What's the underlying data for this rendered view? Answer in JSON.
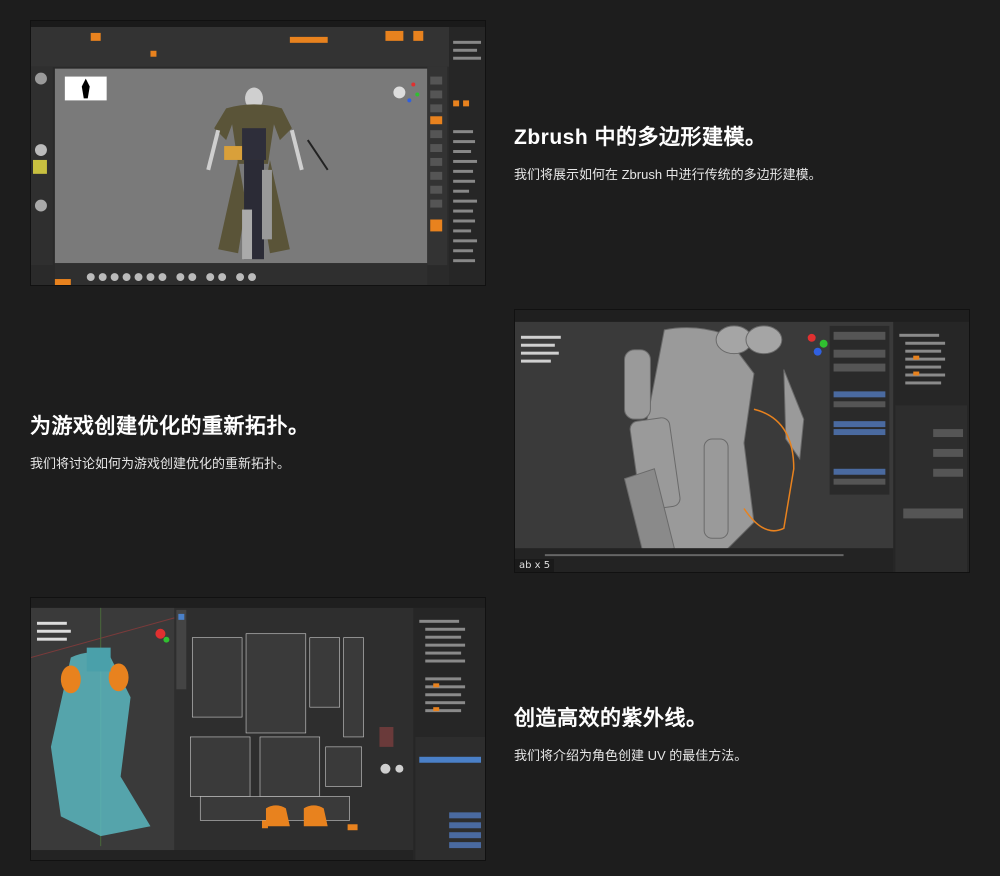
{
  "sections": [
    {
      "heading": "Zbrush 中的多边形建模。",
      "description": "我们将展示如何在 Zbrush 中进行传统的多边形建模。",
      "screenshot": "zbrush-viewport"
    },
    {
      "heading": "为游戏创建优化的重新拓扑。",
      "description": "我们将讨论如何为游戏创建优化的重新拓扑。",
      "screenshot": "blender-retopology-viewport",
      "overlay_text": "ab x 5"
    },
    {
      "heading": "创造高效的紫外线。",
      "description": "我们将介绍为角色创建 UV 的最佳方法。",
      "screenshot": "blender-uv-editor"
    }
  ],
  "colors": {
    "page_bg": "#1d1d1d",
    "accent_orange": "#e8821e",
    "viewport_gray": "#7a7a7a",
    "dark_ui": "#2b2b2b"
  }
}
